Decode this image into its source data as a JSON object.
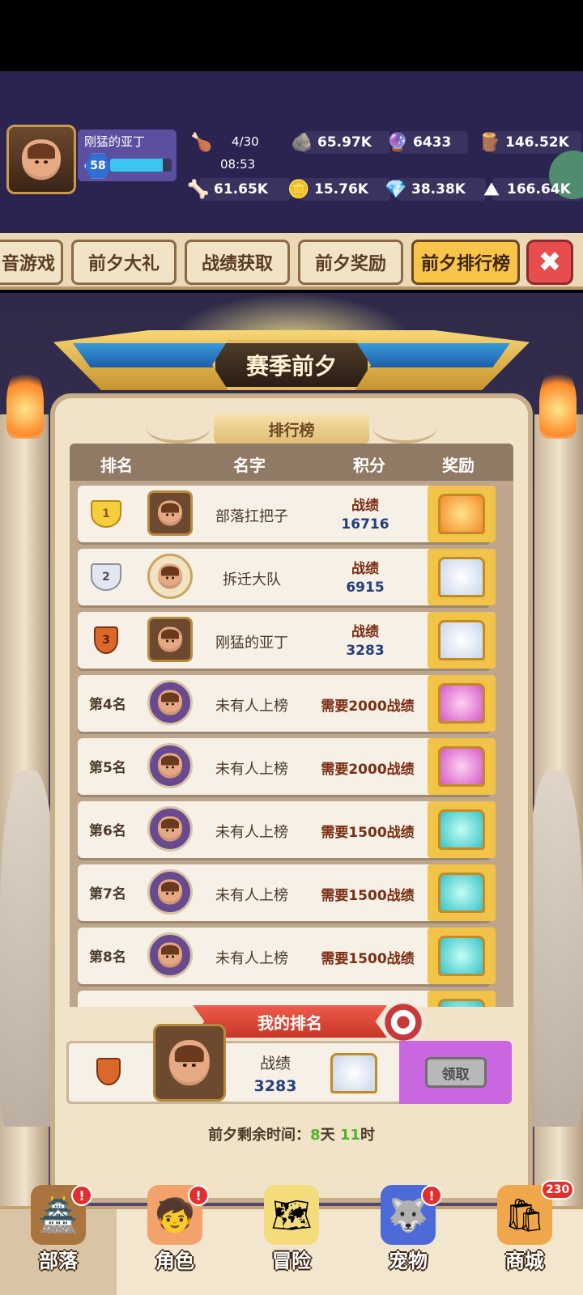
{
  "player": {
    "name": "刚猛的亚丁",
    "level": "58",
    "xp_fraction": 0.85
  },
  "resources": {
    "energy": "4/30",
    "energy_timer": "08:53",
    "stone": "65.97K",
    "gem": "6433",
    "wood": "146.52K",
    "bone": "61.65K",
    "coin": "15.76K",
    "crystal": "38.38K",
    "ore": "166.64K"
  },
  "tabs": [
    {
      "label": "音游戏",
      "active": false
    },
    {
      "label": "前夕大礼",
      "active": false
    },
    {
      "label": "战绩获取",
      "active": false
    },
    {
      "label": "前夕奖励",
      "active": false
    },
    {
      "label": "前夕排行榜",
      "active": true
    }
  ],
  "board": {
    "season_title": "赛季前夕",
    "ribbon": "排行榜",
    "columns": [
      "排名",
      "名字",
      "积分",
      "奖励"
    ],
    "rows": [
      {
        "rank": "1",
        "name": "部落扛把子",
        "label": "战绩",
        "score": "16716",
        "chest": "gold"
      },
      {
        "rank": "2",
        "name": "拆迁大队",
        "label": "战绩",
        "score": "6915",
        "chest": "silver"
      },
      {
        "rank": "3",
        "name": "刚猛的亚丁",
        "label": "战绩",
        "score": "3283",
        "chest": "silver"
      },
      {
        "rank": "第4名",
        "name": "未有人上榜",
        "need": "需要2000战绩",
        "chest": "pink"
      },
      {
        "rank": "第5名",
        "name": "未有人上榜",
        "need": "需要2000战绩",
        "chest": "pink"
      },
      {
        "rank": "第6名",
        "name": "未有人上榜",
        "need": "需要1500战绩",
        "chest": "teal"
      },
      {
        "rank": "第7名",
        "name": "未有人上榜",
        "need": "需要1500战绩",
        "chest": "teal"
      },
      {
        "rank": "第8名",
        "name": "未有人上榜",
        "need": "需要1500战绩",
        "chest": "teal"
      }
    ]
  },
  "my_rank": {
    "title": "我的排名",
    "label": "战绩",
    "score": "3283",
    "claim": "领取"
  },
  "countdown": {
    "prefix": "前夕剩余时间：",
    "days": "8",
    "day_unit": "天",
    "hours": "11",
    "hour_unit": "时"
  },
  "nav": [
    {
      "label": "部落",
      "badge": "!"
    },
    {
      "label": "角色",
      "badge": "!"
    },
    {
      "label": "冒险",
      "badge": ""
    },
    {
      "label": "宠物",
      "badge": "!"
    },
    {
      "label": "商城",
      "count": "230"
    }
  ],
  "colors": {
    "active_tab": "#f8c54a",
    "claim_bg": "#c966e0",
    "badge": "#e12f2f"
  }
}
